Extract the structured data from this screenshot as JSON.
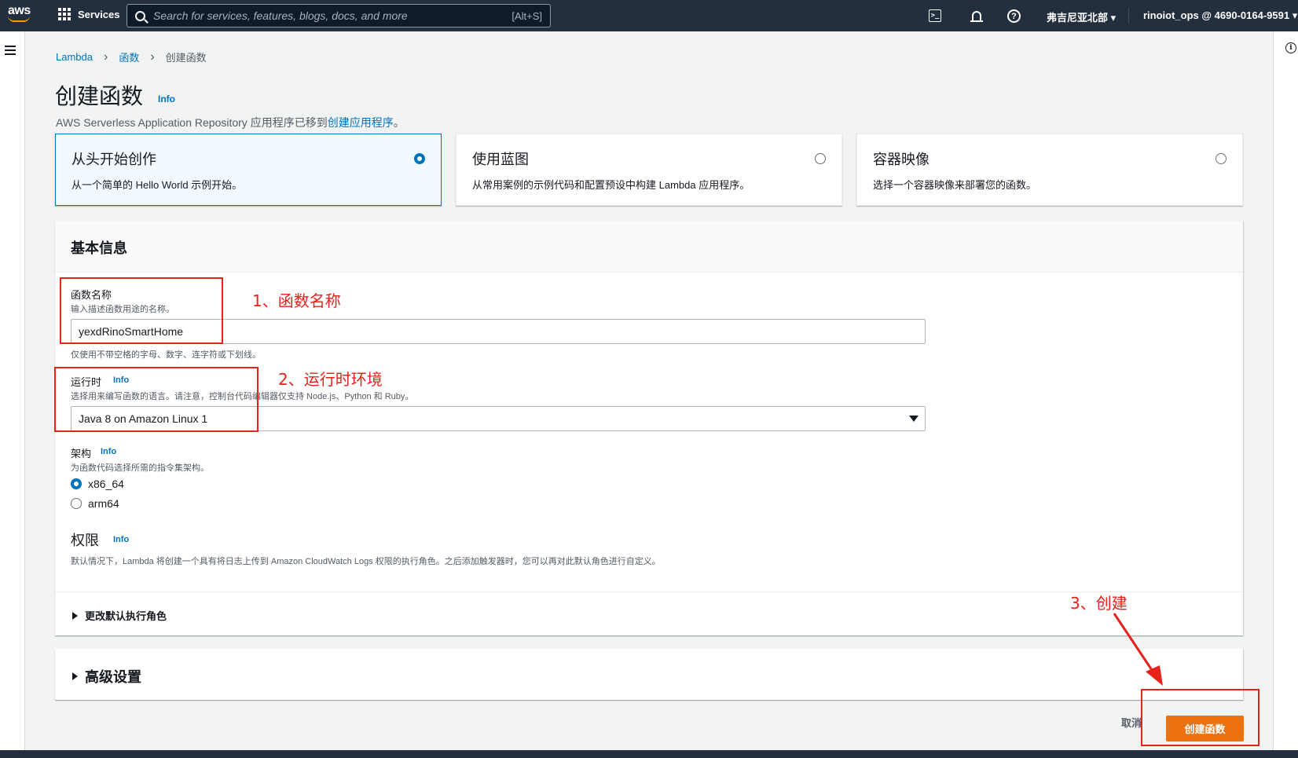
{
  "nav": {
    "logo": "aws",
    "services": "Services",
    "search_placeholder": "Search for services, features, blogs, docs, and more",
    "search_shortcut": "[Alt+S]",
    "region": "弗吉尼亚北部 ▾",
    "account": "rinoiot_ops @ 4690-0164-9591 ▾",
    "icons": [
      "cloudshell-icon",
      "bell-icon",
      "help-icon"
    ]
  },
  "breadcrumb": [
    "Lambda",
    "函数",
    "创建函数"
  ],
  "page": {
    "title": "创建函数",
    "info": "Info",
    "subtitle_prefix": "AWS Serverless Application Repository 应用程序已移到",
    "subtitle_link": "创建应用程序",
    "subtitle_suffix": "。"
  },
  "options": [
    {
      "title": "从头开始创作",
      "desc": "从一个简单的 Hello World 示例开始。",
      "selected": true
    },
    {
      "title": "使用蓝图",
      "desc": "从常用案例的示例代码和配置预设中构建 Lambda 应用程序。",
      "selected": false
    },
    {
      "title": "容器映像",
      "desc": "选择一个容器映像来部署您的函数。",
      "selected": false
    }
  ],
  "basic": {
    "heading": "基本信息",
    "name_label": "函数名称",
    "name_desc": "输入描述函数用途的名称。",
    "name_value": "yexdRinoSmartHome",
    "name_hint": "仅使用不带空格的字母、数字、连字符或下划线。",
    "runtime_label": "运行时",
    "runtime_info": "Info",
    "runtime_desc": "选择用来编写函数的语言。请注意，控制台代码编辑器仅支持 Node.js、Python 和 Ruby。",
    "runtime_value": "Java 8 on Amazon Linux 1",
    "arch_label": "架构",
    "arch_info": "Info",
    "arch_desc": "为函数代码选择所需的指令集架构。",
    "arch_options": [
      "x86_64",
      "arm64"
    ],
    "arch_selected": "x86_64",
    "perm_label": "权限",
    "perm_info": "Info",
    "perm_desc": "默认情况下，Lambda 将创建一个具有将日志上传到 Amazon CloudWatch Logs 权限的执行角色。之后添加触发器时，您可以再对此默认角色进行自定义。",
    "change_role": "更改默认执行角色"
  },
  "advanced": "高级设置",
  "actions": {
    "cancel": "取消",
    "create": "创建函数"
  },
  "annotations": [
    "1、函数名称",
    "2、运行时环境",
    "3、创建"
  ],
  "colors": {
    "accent": "#0073bb",
    "primary_button": "#ec7211",
    "nav_bg": "#232f3e",
    "annotation": "#e8211b"
  }
}
